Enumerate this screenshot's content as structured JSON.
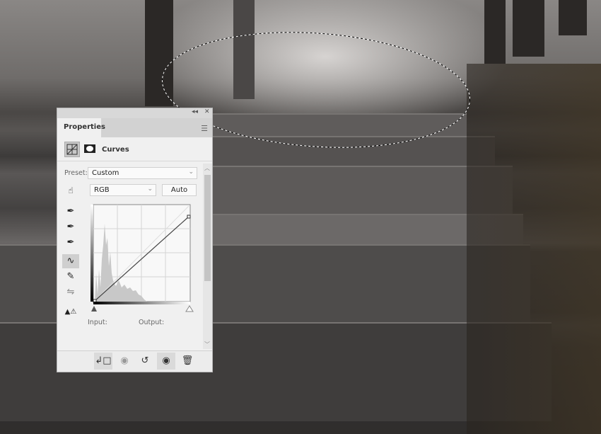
{
  "panel": {
    "title_tab": "Properties",
    "collapse_icon": "double-chevron-left-icon",
    "close_icon": "close-icon",
    "menu_icon": "hamburger-menu-icon",
    "adjustment_name": "Curves",
    "preset_label": "Preset:",
    "preset_value": "Custom",
    "channel_value": "RGB",
    "auto_label": "Auto",
    "input_label": "Input:",
    "output_label": "Output:",
    "tools": [
      "on-image-adjust-icon",
      "black-point-eyedropper-icon",
      "gray-point-eyedropper-icon",
      "white-point-eyedropper-icon",
      "curve-points-icon",
      "pencil-icon",
      "smooth-icon",
      "clipping-warning-icon"
    ],
    "footer_buttons": [
      "clip-to-layer-icon",
      "view-previous-state-icon",
      "reset-icon",
      "visibility-eye-icon",
      "trash-icon"
    ],
    "curve_points": [
      [
        0,
        0
      ],
      [
        255,
        220
      ]
    ]
  }
}
